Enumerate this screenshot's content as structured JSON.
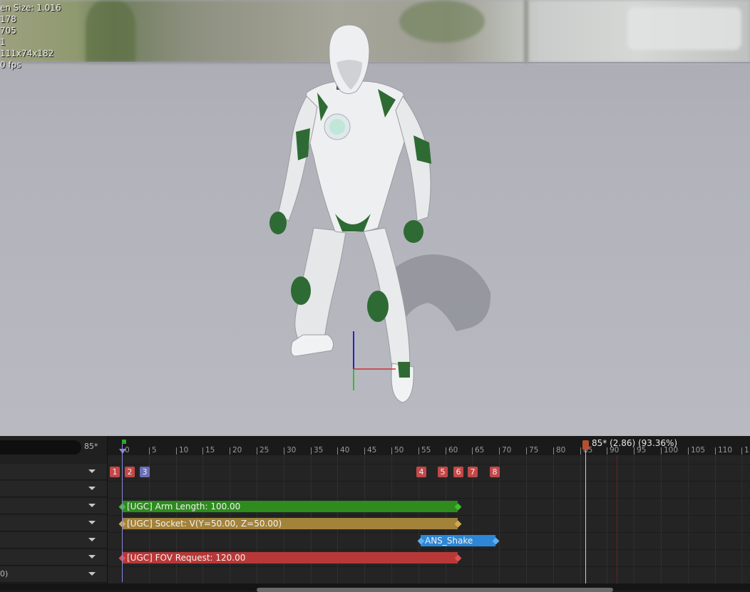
{
  "viewport": {
    "stats": [
      "en Size: 1.016",
      "178",
      "705",
      " 1",
      "111x74x182",
      "0 fps"
    ]
  },
  "timeline": {
    "frame_count": "85*",
    "playhead_label": "85* (2.86) (93.36%)",
    "ruler_labels": [
      "0",
      "5",
      "10",
      "15",
      "20",
      "25",
      "30",
      "35",
      "40",
      "45",
      "50",
      "55",
      "60",
      "65",
      "70",
      "75",
      "80",
      "85",
      "90",
      "95",
      "100",
      "105",
      "110",
      "1"
    ],
    "markers": [
      {
        "label": "1",
        "color": "#c34848"
      },
      {
        "label": "2",
        "color": "#c34848"
      },
      {
        "label": "3",
        "color": "#6b6fb5"
      },
      {
        "label": "4",
        "color": "#c34848"
      },
      {
        "label": "5",
        "color": "#c34848"
      },
      {
        "label": "6",
        "color": "#c34848"
      },
      {
        "label": "7",
        "color": "#c34848"
      },
      {
        "label": "8",
        "color": "#c34848"
      }
    ],
    "notifies": [
      {
        "label": "[UGC] Arm Length: 100.00",
        "color": "#2e8b1e",
        "diamond": "#3fc12f"
      },
      {
        "label": "[UGC] Socket: V(Y=50.00, Z=50.00)",
        "color": "#a3823a",
        "diamond": "#d3a94e"
      },
      {
        "label": "ANS_Shake",
        "color": "#2d87d6",
        "diamond": "#5fb0f0"
      },
      {
        "label": "[UGC] FOV Request: 120.00",
        "color": "#b83838",
        "diamond": "#e05050"
      }
    ],
    "left_rows": [
      "",
      "",
      "",
      "",
      "",
      "",
      "0)"
    ]
  }
}
